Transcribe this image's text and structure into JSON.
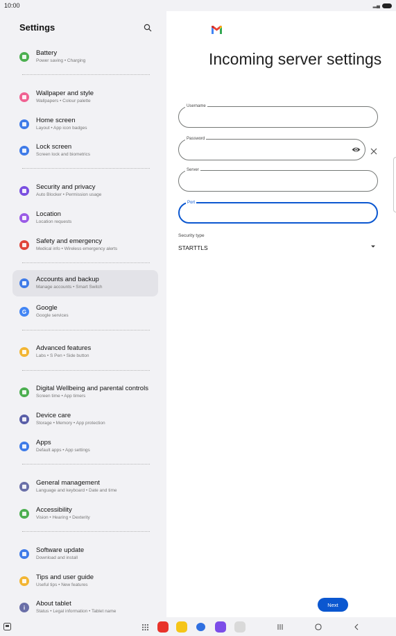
{
  "status_bar": {
    "time": "10:00"
  },
  "left_panel": {
    "title": "Settings",
    "items": [
      {
        "title": "Battery",
        "subtitle": "Power saving  •  Charging",
        "color": "#4caf50"
      },
      {
        "title": "Wallpaper and style",
        "subtitle": "Wallpapers  •  Colour palette",
        "color": "#f06292"
      },
      {
        "title": "Home screen",
        "subtitle": "Layout  •  App icon badges",
        "color": "#3f7be8"
      },
      {
        "title": "Lock screen",
        "subtitle": "Screen lock and biometrics",
        "color": "#3f7be8"
      },
      {
        "title": "Security and privacy",
        "subtitle": "Auto Blocker  •  Permission usage",
        "color": "#7a4fe0"
      },
      {
        "title": "Location",
        "subtitle": "Location requests",
        "color": "#9a5be6"
      },
      {
        "title": "Safety and emergency",
        "subtitle": "Medical info  •  Wireless emergency alerts",
        "color": "#e0453a"
      },
      {
        "title": "Accounts and backup",
        "subtitle": "Manage accounts  •  Smart Switch",
        "color": "#3f7be8"
      },
      {
        "title": "Google",
        "subtitle": "Google services",
        "color": "#4285f4"
      },
      {
        "title": "Advanced features",
        "subtitle": "Labs  •  S Pen  •  Side button",
        "color": "#f2b533"
      },
      {
        "title": "Digital Wellbeing and parental controls",
        "subtitle": "Screen time  •  App timers",
        "color": "#4caf50"
      },
      {
        "title": "Device care",
        "subtitle": "Storage  •  Memory  •  App protection",
        "color": "#5a5fa8"
      },
      {
        "title": "Apps",
        "subtitle": "Default apps  •  App settings",
        "color": "#3f7be8"
      },
      {
        "title": "General management",
        "subtitle": "Language and keyboard  •  Date and time",
        "color": "#6a6fa8"
      },
      {
        "title": "Accessibility",
        "subtitle": "Vision  •  Hearing  •  Dexterity",
        "color": "#4caf50"
      },
      {
        "title": "Software update",
        "subtitle": "Download and install",
        "color": "#3f7be8"
      },
      {
        "title": "Tips and user guide",
        "subtitle": "Useful tips  •  New features",
        "color": "#f2b533"
      },
      {
        "title": "About tablet",
        "subtitle": "Status  •  Legal information  •  Tablet name",
        "color": "#6a6fa8"
      }
    ]
  },
  "right_panel": {
    "title": "Incoming server settings",
    "fields": {
      "username": {
        "label": "Username",
        "value": ""
      },
      "password": {
        "label": "Password",
        "value": ""
      },
      "server": {
        "label": "Server",
        "value": ""
      },
      "port": {
        "label": "Port",
        "value": ""
      }
    },
    "security_type": {
      "label": "Security type",
      "value": "STARTTLS"
    },
    "next_label": "Next"
  },
  "colors": {
    "accent": "#0b57d0",
    "panel_bg": "#f2f2f5",
    "active_item": "#e3e3e8"
  }
}
